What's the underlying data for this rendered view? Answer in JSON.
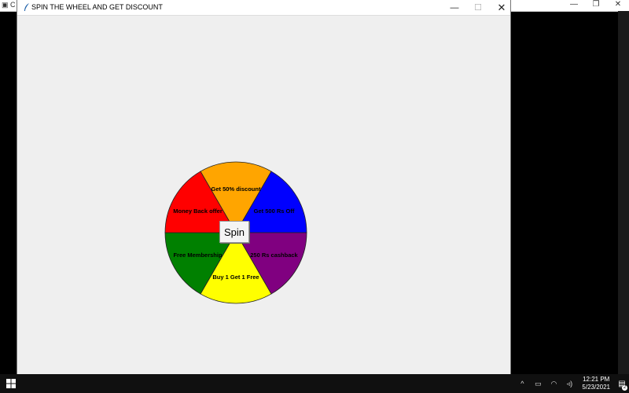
{
  "window": {
    "title": "SPIN THE WHEEL AND GET DISCOUNT"
  },
  "wheel": {
    "segments": [
      {
        "label": "Get 50% discount",
        "color": "#ffa500"
      },
      {
        "label": "Get 500 Rs Off",
        "color": "#0000ff"
      },
      {
        "label": "250 Rs cashback",
        "color": "#800080"
      },
      {
        "label": "Buy 1 Get 1 Free",
        "color": "#ffff00"
      },
      {
        "label": "Free Membership",
        "color": "#008000"
      },
      {
        "label": "Money Back offer",
        "color": "#ff0000"
      }
    ],
    "spin_label": "Spin"
  },
  "taskbar": {
    "time": "12:21 PM",
    "date": "5/23/2021",
    "notification_count": "2"
  },
  "icons": {
    "app": "feather-icon",
    "start": "windows-logo-icon"
  }
}
